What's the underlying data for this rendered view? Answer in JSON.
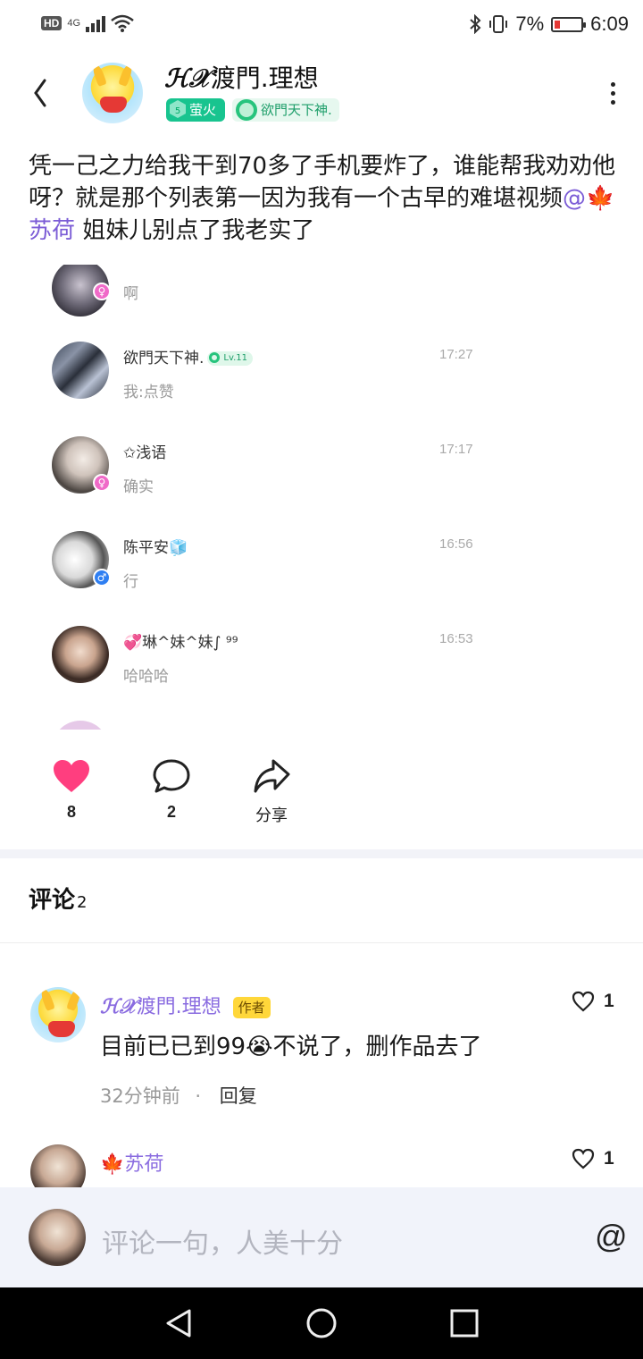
{
  "status_bar": {
    "hd": "HD",
    "network": "4G",
    "battery_percent": "7%",
    "time": "6:09"
  },
  "header": {
    "username_prefix": "ℋ𝒳",
    "username": "渡門.理想",
    "badge_level": "5",
    "badge_1": "萤火",
    "badge_2": "欲門天下神."
  },
  "post": {
    "text": "凭一己之力给我干到70多了手机要炸了，谁能帮我劝劝他呀？就是那个列表第一因为我有一个古早的难堪视频",
    "mention": "@🍁苏荷",
    "text_after": " 姐妹儿别点了我老实了"
  },
  "chat_list": [
    {
      "name": "",
      "msg": "啊",
      "time": "",
      "gender": "♀"
    },
    {
      "name": "欲門天下神.",
      "level": "Lv.11",
      "msg": "我:点赞",
      "time": "17:27",
      "gender": ""
    },
    {
      "name": "✩浅语",
      "msg": "确实",
      "time": "17:17",
      "gender": "♀"
    },
    {
      "name": "陈平安🧊",
      "msg": "行",
      "time": "16:56",
      "gender": "♂"
    },
    {
      "name": "💞琳^妹^妹∫ ⁹⁹",
      "msg": "哈哈哈",
      "time": "16:53",
      "gender": ""
    },
    {
      "name": "",
      "msg": "",
      "time": "",
      "gender": ""
    }
  ],
  "actions": {
    "likes": "8",
    "comments": "2",
    "share": "分享"
  },
  "comments_section": {
    "title": "评论",
    "count": "2",
    "items": [
      {
        "name_prefix": "ℋ𝒳",
        "name": "渡門.理想",
        "tag": "作者",
        "text": "目前已已到99😭不说了，删作品去了",
        "time": "32分钟前",
        "separator": "·",
        "reply": "回复",
        "likes": "1"
      },
      {
        "name": "🍁苏荷",
        "likes": "1"
      }
    ]
  },
  "input": {
    "placeholder": "评论一句，人美十分",
    "at": "@"
  },
  "colors": {
    "accent_purple": "#7b5cd6",
    "like_pink": "#ff3e7f",
    "badge_green": "#18c48f",
    "author_yellow": "#ffd73a"
  }
}
